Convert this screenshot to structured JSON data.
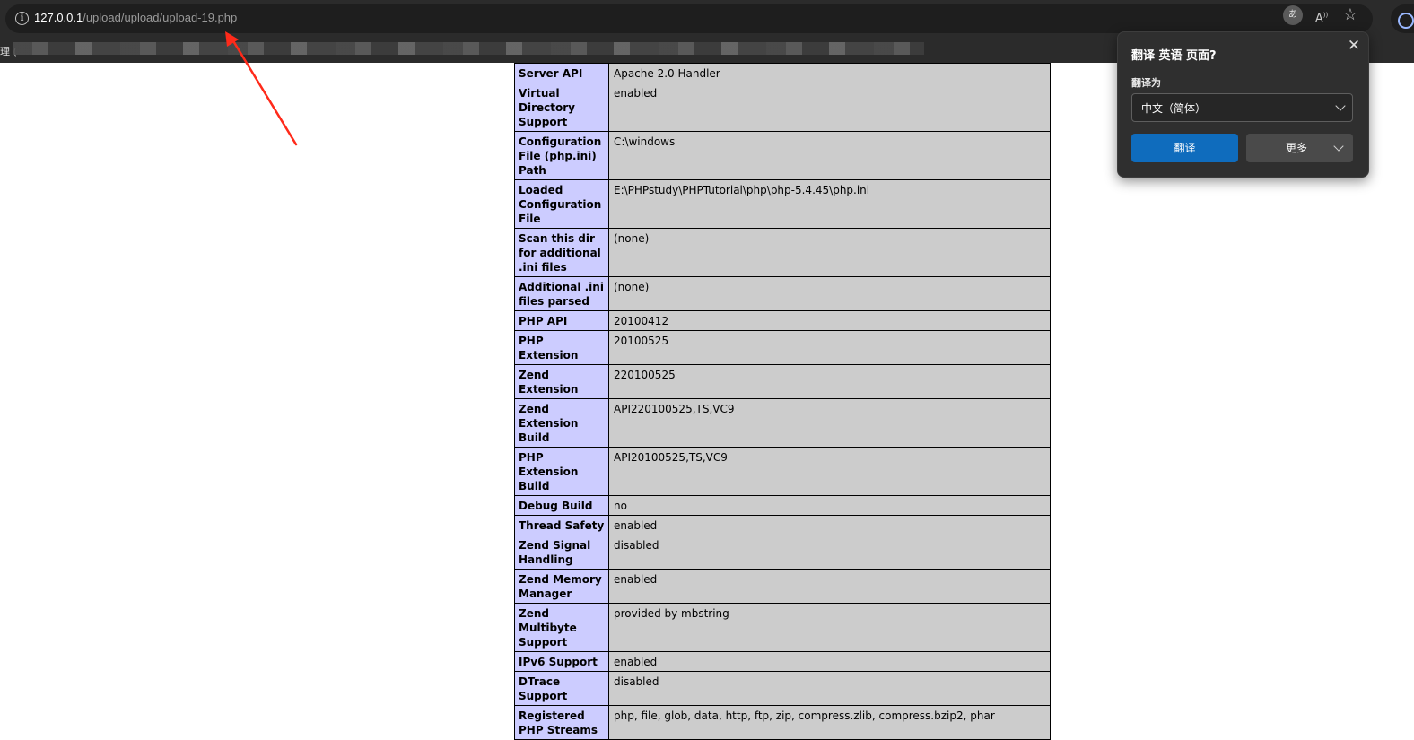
{
  "browser": {
    "url_host": "127.0.0.1",
    "url_path": "/upload/upload/upload-19.php",
    "bookmarks_visible_text": "理 ("
  },
  "phpinfo_rows": [
    {
      "key": "Server API",
      "value": "Apache 2.0 Handler"
    },
    {
      "key": "Virtual Directory Support",
      "value": "enabled"
    },
    {
      "key": "Configuration File (php.ini) Path",
      "value": "C:\\windows"
    },
    {
      "key": "Loaded Configuration File",
      "value": "E:\\PHPstudy\\PHPTutorial\\php\\php-5.4.45\\php.ini"
    },
    {
      "key": "Scan this dir for additional .ini files",
      "value": "(none)"
    },
    {
      "key": "Additional .ini files parsed",
      "value": "(none)"
    },
    {
      "key": "PHP API",
      "value": "20100412"
    },
    {
      "key": "PHP Extension",
      "value": "20100525"
    },
    {
      "key": "Zend Extension",
      "value": "220100525"
    },
    {
      "key": "Zend Extension Build",
      "value": "API220100525,TS,VC9"
    },
    {
      "key": "PHP Extension Build",
      "value": "API20100525,TS,VC9"
    },
    {
      "key": "Debug Build",
      "value": "no"
    },
    {
      "key": "Thread Safety",
      "value": "enabled"
    },
    {
      "key": "Zend Signal Handling",
      "value": "disabled"
    },
    {
      "key": "Zend Memory Manager",
      "value": "enabled"
    },
    {
      "key": "Zend Multibyte Support",
      "value": "provided by mbstring"
    },
    {
      "key": "IPv6 Support",
      "value": "enabled"
    },
    {
      "key": "DTrace Support",
      "value": "disabled"
    },
    {
      "key": "Registered PHP Streams",
      "value": "php, file, glob, data, http, ftp, zip, compress.zlib, compress.bzip2, phar"
    }
  ],
  "translate_popup": {
    "title": "翻译 英语 页面?",
    "translate_to_label": "翻译为",
    "target_language": "中文（简体）",
    "translate_button": "翻译",
    "more_button": "更多"
  },
  "icons": {
    "site_info": "info-icon",
    "translate": "translate-icon",
    "read_aloud": "read-aloud-icon",
    "favorite": "star-icon",
    "close": "close-icon"
  },
  "colors": {
    "php_key_bg": "#ccccff",
    "php_value_bg": "#cccccc",
    "translate_primary": "#0f6cbd",
    "annotation_arrow": "#ff2a1a"
  }
}
